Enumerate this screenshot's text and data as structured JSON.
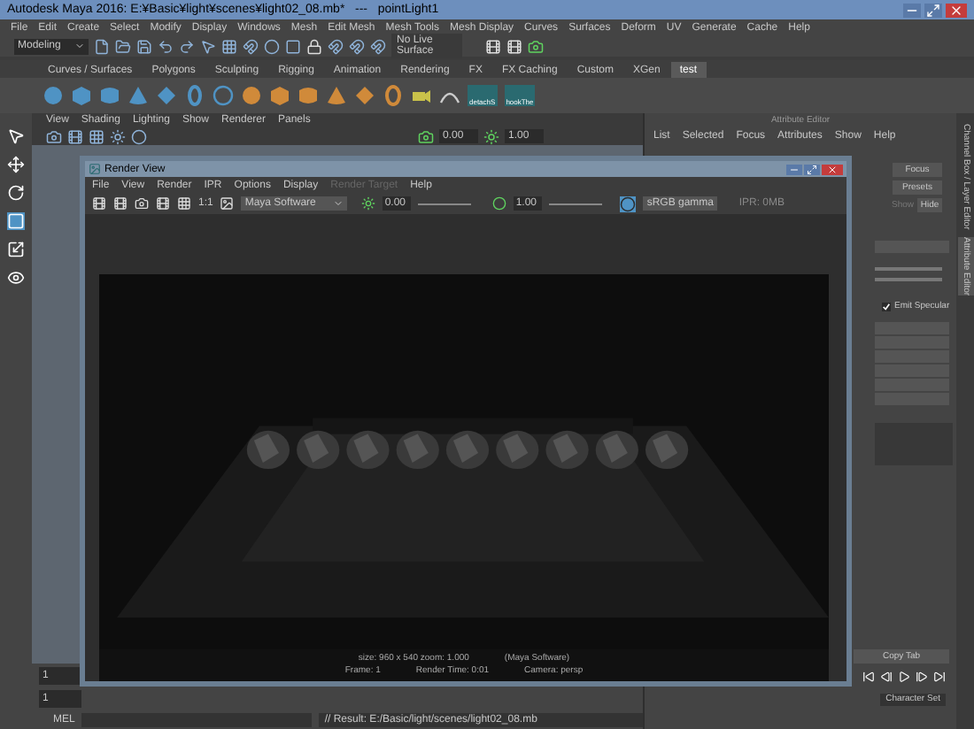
{
  "window": {
    "title": "Autodesk Maya 2016: E:¥Basic¥light¥scenes¥light02_08.mb*   ---   pointLight1"
  },
  "menu": [
    "File",
    "Edit",
    "Create",
    "Select",
    "Modify",
    "Display",
    "Windows",
    "Mesh",
    "Edit Mesh",
    "Mesh Tools",
    "Mesh Display",
    "Curves",
    "Surfaces",
    "Deform",
    "UV",
    "Generate",
    "Cache",
    "Help"
  ],
  "status_line": {
    "mode": "Modeling",
    "live_surface": "No Live Surface"
  },
  "shelf_tabs": [
    {
      "label": "Curves / Surfaces",
      "selected": false
    },
    {
      "label": "Polygons",
      "selected": false
    },
    {
      "label": "Sculpting",
      "selected": false
    },
    {
      "label": "Rigging",
      "selected": false
    },
    {
      "label": "Animation",
      "selected": false
    },
    {
      "label": "Rendering",
      "selected": false
    },
    {
      "label": "FX",
      "selected": false
    },
    {
      "label": "FX Caching",
      "selected": false
    },
    {
      "label": "Custom",
      "selected": false
    },
    {
      "label": "XGen",
      "selected": false
    },
    {
      "label": "test",
      "selected": true
    }
  ],
  "shelf_labels": [
    "detachS",
    "hookThe"
  ],
  "viewport": {
    "menu": [
      "View",
      "Shading",
      "Lighting",
      "Show",
      "Renderer",
      "Panels"
    ],
    "exposure": "0.00",
    "gamma": "1.00"
  },
  "attribute_editor": {
    "title": "Attribute Editor",
    "menu": [
      "List",
      "Selected",
      "Focus",
      "Attributes",
      "Show",
      "Help"
    ],
    "buttons": [
      "Focus",
      "Presets"
    ],
    "show_label": "Show",
    "hide_button": "Hide",
    "emit_specular": {
      "label": "Emit Specular",
      "checked": true
    },
    "copy_tab": "Copy Tab"
  },
  "side_tabs": [
    "Channel Box / Layer Editor",
    "Attribute Editor"
  ],
  "render_view": {
    "title": "Render View",
    "menu": [
      {
        "label": "File",
        "disabled": false
      },
      {
        "label": "View",
        "disabled": false
      },
      {
        "label": "Render",
        "disabled": false
      },
      {
        "label": "IPR",
        "disabled": false
      },
      {
        "label": "Options",
        "disabled": false
      },
      {
        "label": "Display",
        "disabled": false
      },
      {
        "label": "Render Target",
        "disabled": true
      },
      {
        "label": "Help",
        "disabled": false
      }
    ],
    "ratio": "1:1",
    "renderer": "Maya Software",
    "exposure": "0.00",
    "gamma": "1.00",
    "color_space": "sRGB gamma",
    "ipr": "IPR: 0MB",
    "info": [
      [
        "size: 960 x 540 zoom: 1.000",
        "(Maya Software)"
      ],
      [
        "Frame: 1",
        "Render Time: 0:01",
        "Camera: persp"
      ]
    ]
  },
  "time": {
    "start": "1",
    "current": "1",
    "character_set": "Character Set"
  },
  "command_line": {
    "language": "MEL",
    "result": "// Result: E:/Basic/light/scenes/light02_08.mb"
  }
}
